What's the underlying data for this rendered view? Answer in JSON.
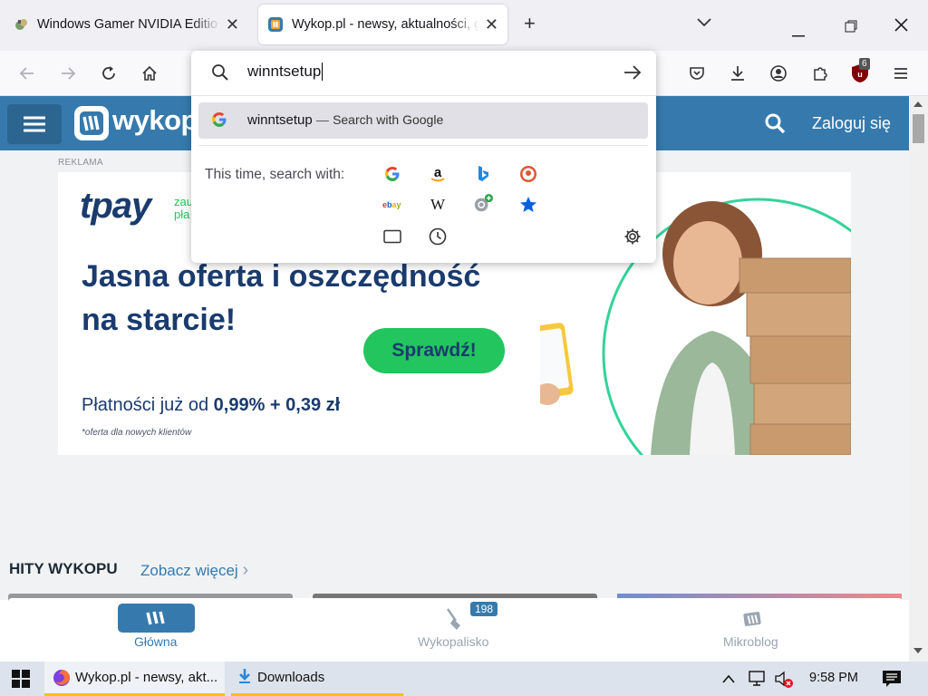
{
  "tabs": [
    {
      "title": "Windows Gamer NVIDIA Editio",
      "close": "✕"
    },
    {
      "title": "Wykop.pl - newsy, aktualności, g",
      "close": "✕"
    }
  ],
  "new_tab_label": "+",
  "window_controls": {
    "list": "⌄",
    "min": "—",
    "restore": "❐",
    "close": "✕"
  },
  "urlbar": {
    "value": "winntsetup",
    "go": "→"
  },
  "suggestion": {
    "query": "winntsetup",
    "sep": "—",
    "action": "Search with Google"
  },
  "one_off": {
    "label": "This time, search with:"
  },
  "extension_badge": "6",
  "site": {
    "logo": "wykop",
    "logo_tail": ".",
    "login": "Zaloguj się"
  },
  "ad": {
    "tag": "REKLAMA",
    "brand": "tpay",
    "brand_sub1": "zau",
    "brand_sub2": "pła",
    "headline1": "Jasna oferta i oszczędność",
    "headline2": "na starcie!",
    "cta": "Sprawdź!",
    "price_text": "Płatności już od",
    "price_value": "0,99% + 0,39 zł",
    "footnote": "*oferta dla nowych klientów"
  },
  "hits": {
    "title": "HITY WYKOPU",
    "more": "Zobacz więcej"
  },
  "bottom_nav": [
    {
      "label": "Główna"
    },
    {
      "label": "Wykopalisko",
      "badge": "198"
    },
    {
      "label": "Mikroblog"
    }
  ],
  "taskbar": {
    "firefox_task": "Wykop.pl - newsy, akt...",
    "downloads_task": "Downloads",
    "time": "9:58 PM"
  },
  "colors": {
    "wykop_blue": "#367aad",
    "tpay_navy": "#1a3b6e",
    "tpay_green": "#22c55e"
  }
}
